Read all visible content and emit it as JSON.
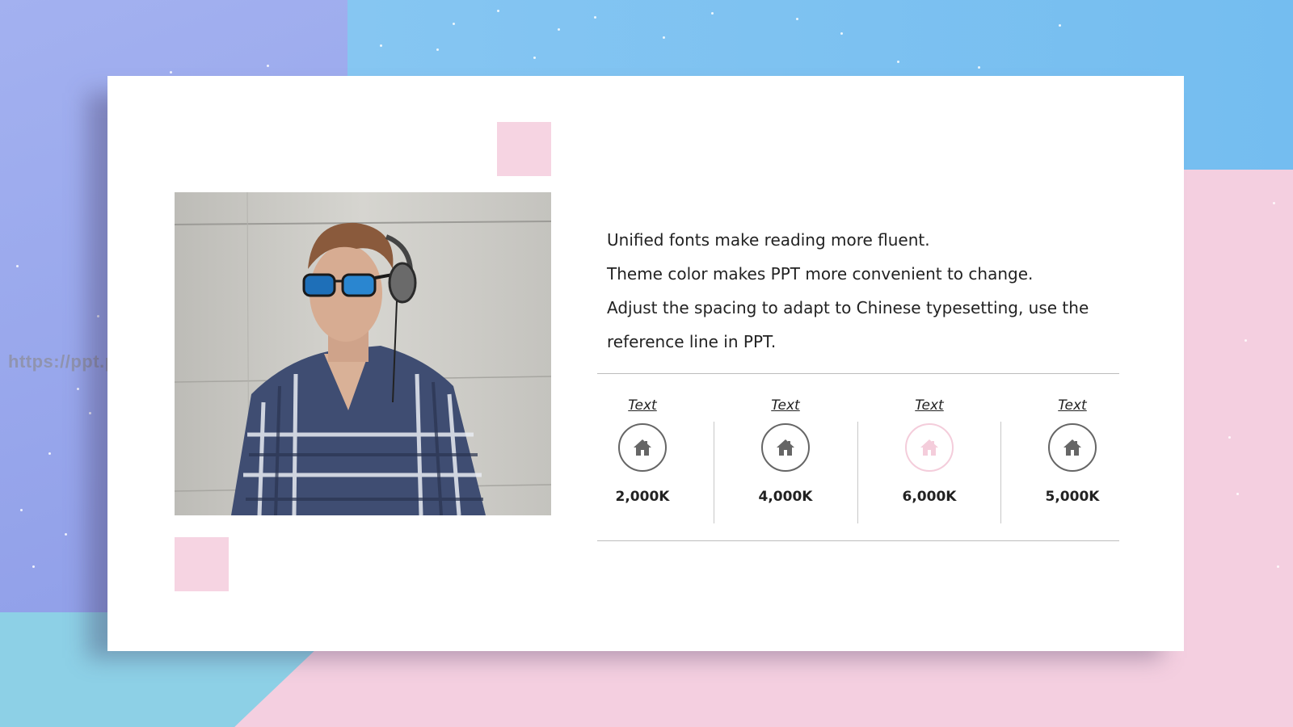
{
  "watermark": "https://ppt.pkll.de",
  "body_text": {
    "line1": "Unified fonts make reading more fluent.",
    "line2": "Theme color makes PPT more convenient to change.",
    "line3": "Adjust the spacing to adapt to Chinese typesetting, use the",
    "line4": "reference line in PPT."
  },
  "stats": [
    {
      "label": "Text",
      "value": "2,000K",
      "icon": "house-icon",
      "color": "#666666"
    },
    {
      "label": "Text",
      "value": "4,000K",
      "icon": "house-icon",
      "color": "#666666"
    },
    {
      "label": "Text",
      "value": "6,000K",
      "icon": "house-icon",
      "color": "#f4cddb"
    },
    {
      "label": "Text",
      "value": "5,000K",
      "icon": "house-icon",
      "color": "#666666"
    }
  ],
  "photo": {
    "icon": "man-with-headphones-photo"
  }
}
